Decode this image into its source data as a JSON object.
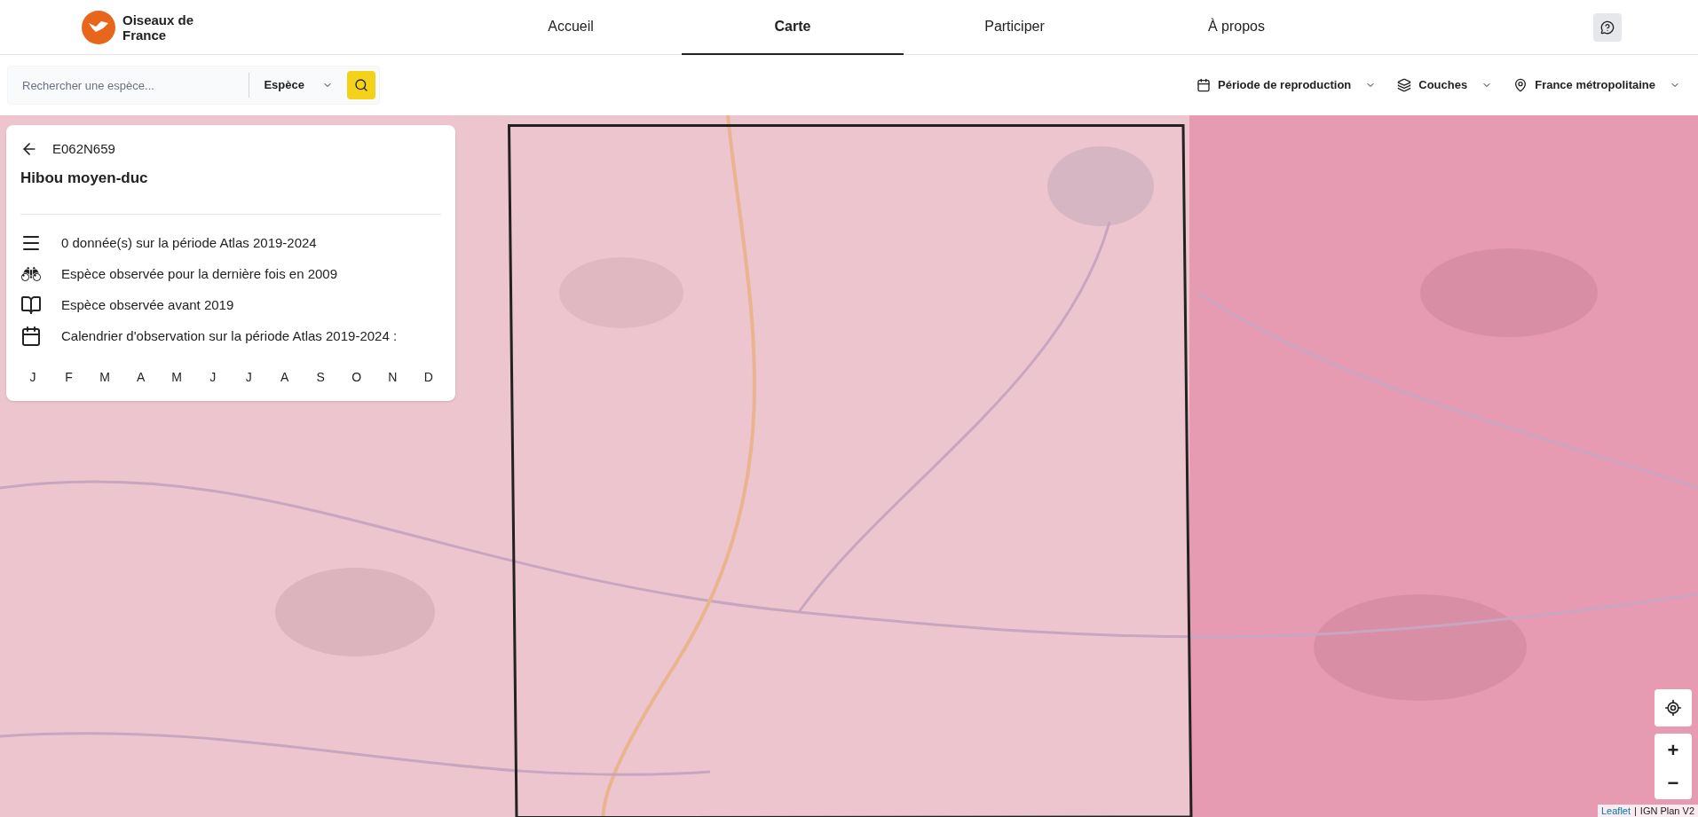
{
  "brand": {
    "name": "Oiseaux de France"
  },
  "nav": [
    {
      "label": "Accueil",
      "selected": false
    },
    {
      "label": "Carte",
      "selected": true
    },
    {
      "label": "Participer",
      "selected": false
    },
    {
      "label": "À propos",
      "selected": false
    }
  ],
  "search": {
    "placeholder": "Rechercher une espèce...",
    "type_select": "Espèce"
  },
  "filters": [
    {
      "kind": "calendar",
      "label": "Période de reproduction"
    },
    {
      "kind": "layers",
      "label": "Couches"
    },
    {
      "kind": "pin",
      "label": "France métropolitaine"
    }
  ],
  "panel": {
    "cell_code": "E062N659",
    "species": "Hibou moyen-duc",
    "rows": [
      {
        "kind": "list",
        "text": "0 donnée(s) sur la période Atlas 2019-2024"
      },
      {
        "kind": "binoculars",
        "text": "Espèce observée pour la dernière fois en 2009"
      },
      {
        "kind": "book",
        "text": "Espèce observée avant 2019"
      },
      {
        "kind": "calendar",
        "text": "Calendrier d'observation sur la période Atlas 2019-2024 :"
      }
    ],
    "months": [
      "J",
      "F",
      "M",
      "A",
      "M",
      "J",
      "J",
      "A",
      "S",
      "O",
      "N",
      "D"
    ]
  },
  "map_controls": {
    "zoom_in": "+",
    "zoom_out": "−"
  },
  "attribution": {
    "link": "Leaflet",
    "separator": "|",
    "source": "IGN Plan V2"
  }
}
